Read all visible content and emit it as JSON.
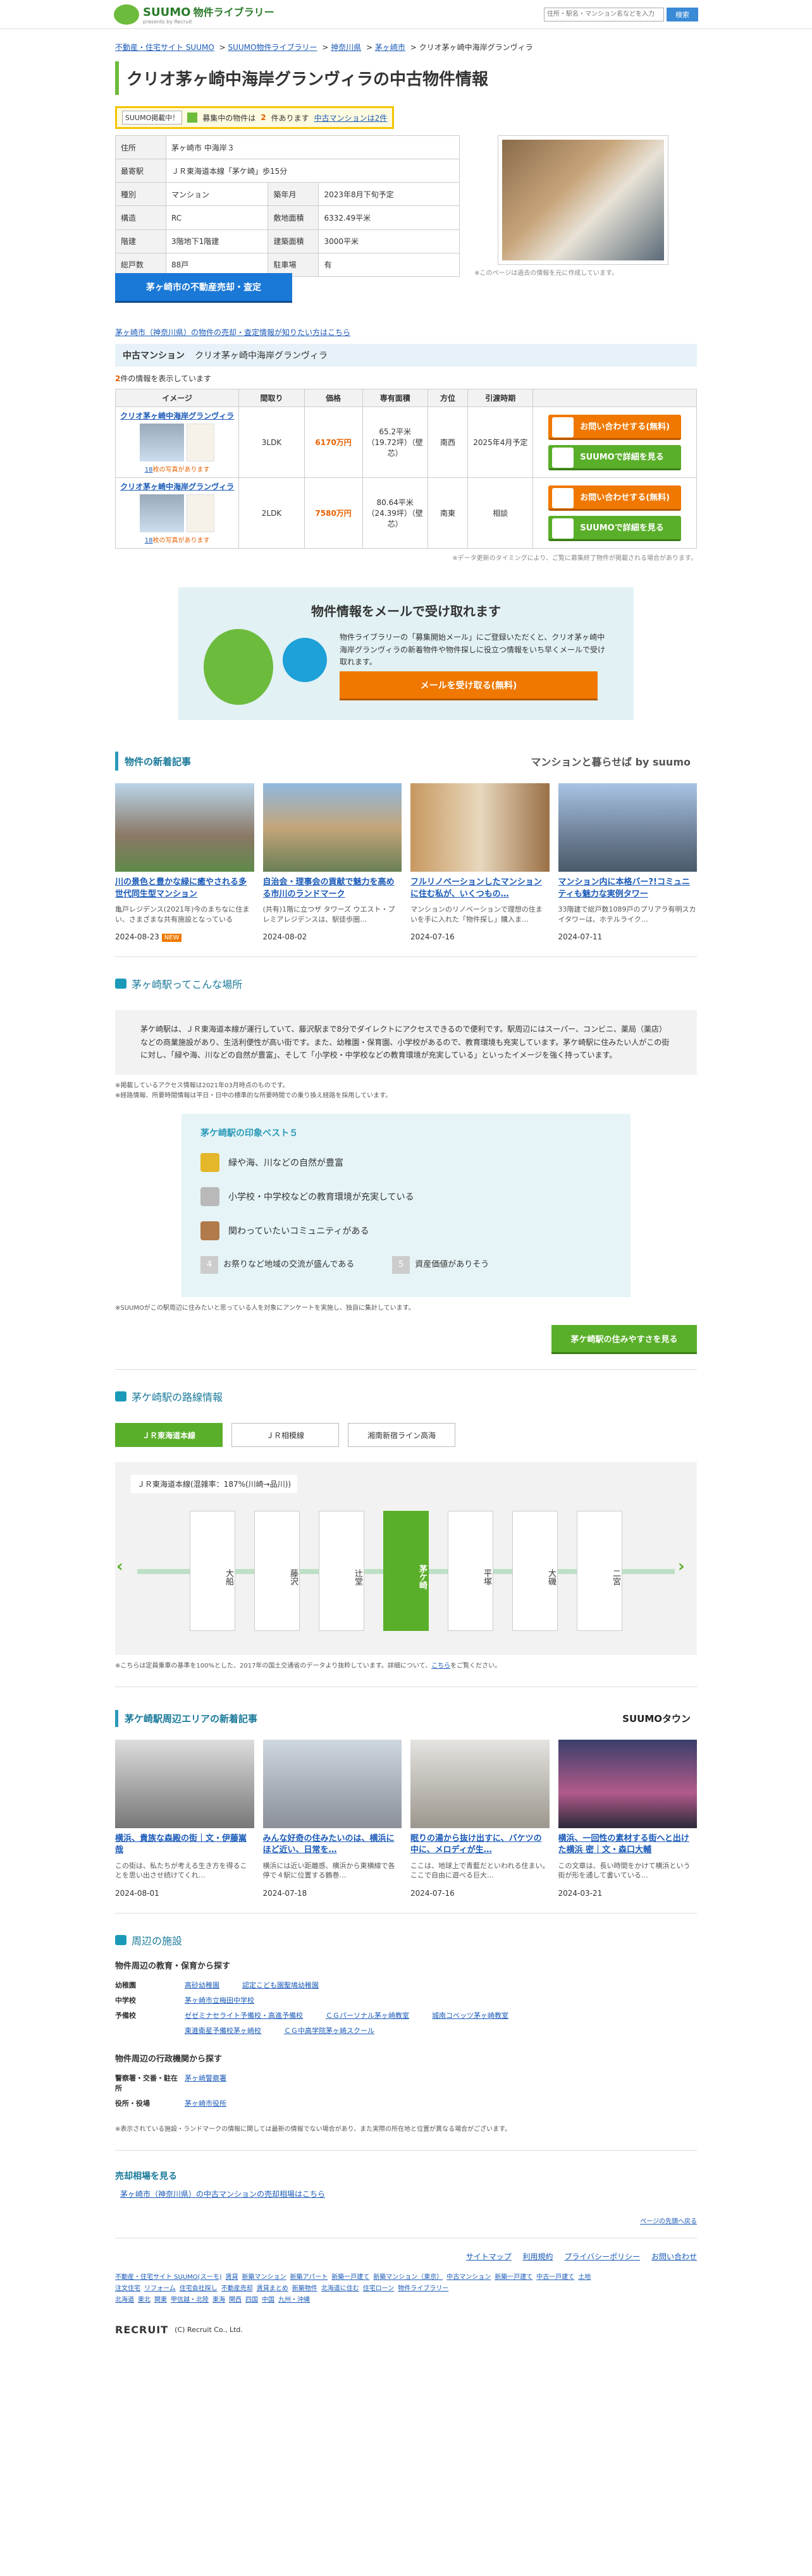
{
  "header": {
    "brand": "SUUMO",
    "brand2": "物件",
    "brand3": "ライブラリー",
    "tagline": "presents by Recruit",
    "search_placeholder": "住所・駅名・マンション名などを入力",
    "search_btn": "検索"
  },
  "crumbs": [
    "不動産・住宅サイト SUUMO",
    "SUUMO物件ライブラリー",
    "神奈川県",
    "茅ヶ崎市",
    "クリオ茅ヶ崎中海岸グランヴィラ"
  ],
  "title": "クリオ茅ヶ崎中海岸グランヴィラの中古物件情報",
  "notice": {
    "tag": "SUUMO掲載中！",
    "text1": "募集中の物件は",
    "n": "2",
    "text2": "件あります",
    "link": "中古マンションは2件"
  },
  "info": [
    {
      "k": "住所",
      "v": "茅ヶ崎市 中海岸３",
      "k2": "",
      "v2": ""
    },
    {
      "k": "最寄駅",
      "v": "ＪＲ東海道本線「茅ケ崎」歩15分",
      "k2": "",
      "v2": ""
    },
    {
      "k": "種別",
      "v": "マンション",
      "k2": "築年月",
      "v2": "2023年8月下旬予定"
    },
    {
      "k": "構造",
      "v": "RC",
      "k2": "敷地面積",
      "v2": "6332.49平米"
    },
    {
      "k": "階建",
      "v": "3階地下1階建",
      "k2": "建築面積",
      "v2": "3000平米"
    },
    {
      "k": "総戸数",
      "v": "88戸",
      "k2": "駐車場",
      "v2": "有"
    }
  ],
  "photo_note": "※このページは過去の情報を元に作成しています。",
  "sell_btn": "茅ヶ崎市の不動産売却・査定",
  "link_sell": "茅ヶ崎市（神奈川県）の物件の売却・査定情報が知りたい方はこちら",
  "section": {
    "label": "中古マンション",
    "name": "クリオ茅ヶ崎中海岸グランヴィラ"
  },
  "count": {
    "n": "2",
    "t": "件の情報を表示しています"
  },
  "table_headers": [
    "イメージ",
    "間取り",
    "価格",
    "専有面積",
    "方位",
    "引渡時期",
    ""
  ],
  "rows": [
    {
      "name": "クリオ茅ヶ崎中海岸グランヴィラ",
      "photos": "18",
      "photo_t": "枚の写真があります",
      "madori": "3LDK",
      "price": "6170万円",
      "area": "65.2平米（19.72坪）（壁芯）",
      "dir": "南西",
      "hand": "2025年4月予定"
    },
    {
      "name": "クリオ茅ヶ崎中海岸グランヴィラ",
      "photos": "18",
      "photo_t": "枚の写真があります",
      "madori": "2LDK",
      "price": "7580万円",
      "area": "80.64平米（24.39坪）（壁芯）",
      "dir": "南東",
      "hand": "相談"
    }
  ],
  "btn_inquiry": "お問い合わせする(無料)",
  "btn_detail": "SUUMOで詳細を見る",
  "table_note": "※データ更新のタイミングにより、ご覧に募集終了物件が掲載される場合があります。",
  "mail": {
    "title": "物件情報をメールで受け取れます",
    "text": "物件ライブラリーの「募集開始メール」にご登録いただくと、クリオ茅ヶ崎中海岸グランヴィラの新着物件や物件探しに役立つ情報をいち早くメールで受け取れます。",
    "btn": "メールを受け取る(無料)"
  },
  "news": {
    "title": "物件の新着記事",
    "logo": "マンションと暮らせば by suumo",
    "items": [
      {
        "t": "川の景色と豊かな緑に癒やされる多世代同生型マンション",
        "p": "亀戸レジデンス(2021年)今のまちなに住まい、さまざまな共有施設となっている",
        "d": "2024-08-23",
        "new": "NEW"
      },
      {
        "t": "自治会・理事会の貢献で魅力を高める市川のランドマーク",
        "p": "(共有)1階に立つザ タワーズ ウエスト・プレミアレジデンスは、駅徒歩圏…",
        "d": "2024-08-02",
        "new": ""
      },
      {
        "t": "フルリノベーションしたマンションに住む私が、いくつもの…",
        "p": "マンションのリノベーションで理想の住まいを手に入れた「物件探し」購入ま…",
        "d": "2024-07-16",
        "new": ""
      },
      {
        "t": "マンション内に本格バー?!コミュニティも魅力な実例タワー",
        "p": "33階建で総戸数1089戸のプリアラ有明スカイタワーは、ホテルライク…",
        "d": "2024-07-11",
        "new": ""
      }
    ]
  },
  "station": {
    "title": "茅ヶ崎駅ってこんな場所",
    "about": "茅ケ崎駅は、ＪＲ東海道本線が運行していて、藤沢駅まで8分でダイレクトにアクセスできるので便利です。駅周辺にはスーパー、コンビニ、薬局（薬店）などの商業施設があり、生活利便性が高い街です。また、幼稚園・保育園、小学校があるので、教育環境も充実しています。茅ケ崎駅に住みたい人がこの街に対し、「緑や海、川などの自然が豊富」、そして「小学校・中学校などの教育環境が充実している」といったイメージを強く持っています。",
    "note1": "※掲載しているアクセス情報は2021年03月時点のものです。",
    "note2": "※経路情報、所要時間情報は平日・日中の標準的な所要時間での乗り換え経路を採用しています。",
    "best_title": "茅ケ崎駅の印象ベスト５",
    "best": [
      "緑や海、川などの自然が豊富",
      "小学校・中学校などの教育環境が充実している",
      "関わっていたいコミュニティがある",
      "お祭りなど地域の交流が盛んである",
      "資産価値がありそう"
    ],
    "best_note": "※SUUMOがこの駅周辺に住みたいと思っている人を対象にアンケートを実施し、独自に集計しています。",
    "btn": "茅ケ崎駅の住みやすさを見る"
  },
  "route": {
    "title": "茅ケ崎駅の路線情報",
    "tabs": [
      "ＪＲ東海道本線",
      "ＪＲ相模線",
      "湘南新宿ライン高海"
    ],
    "caption": "ＪＲ東海道本線(混雑率：187%(川崎→品川))",
    "stations": [
      "大船",
      "藤沢",
      "辻堂",
      "茅ケ崎",
      "平塚",
      "大磯",
      "二宮"
    ],
    "note": "※こちらは定員乗車の基準を100%とした、2017年の国土交通省のデータより抜粋しています。詳細について、",
    "note_link": "こちら",
    "note_end": "をご覧ください。"
  },
  "area_news": {
    "title": "茅ケ崎駅周辺エリアの新着記事",
    "logo": "SUUMOタウン",
    "items": [
      {
        "t": "横浜、貴族な森殿の街｜文・伊藤嵩哉",
        "p": "この街は、私たちが考える生き方を得ることを思い出させ続けてくれ…",
        "d": "2024-08-01"
      },
      {
        "t": "みんな好奇の住みたいのは、横浜にほど近い、日常を…",
        "p": "横浜には近い距離感、横浜から東横線で各停で４駅に位置する鶴巻…",
        "d": "2024-07-18"
      },
      {
        "t": "眠りの湯から抜け出すに、バケツの中に、メロディが生…",
        "p": "ここは、地球上で青藍だといわれる住まい。ここで自由に遊べる巨大…",
        "d": "2024-07-16"
      },
      {
        "t": "横浜、一回性の素材する街へと出けた横浜 密｜文・森口大輔",
        "p": "この文章は、長い時間をかけて横浜という街が形を通して書いている…",
        "d": "2024-03-21"
      }
    ]
  },
  "facility": {
    "title": "周辺の施設",
    "edu": "物件周辺の教育・保育から探す",
    "rows": [
      {
        "k": "幼稚園",
        "v": [
          "高砂幼稚園",
          "認定こども園聖鳩幼稚園"
        ]
      },
      {
        "k": "中学校",
        "v": [
          "茅ヶ崎市立梅田中学校"
        ]
      },
      {
        "k": "予備校",
        "v": [
          "ゼゼミナセライト予備校・高進予備校",
          "ＣＧパーソナル茅ヶ崎教室",
          "城南コベッツ茅ヶ崎教室",
          "東進衛星予備校茅ヶ崎校",
          "ＣＧ中高学院茅ヶ崎スクール"
        ]
      }
    ],
    "gov": "物件周辺の行政機関から探す",
    "rows2": [
      {
        "k": "警察署・交番・駐在所",
        "v": [
          "茅ヶ崎警察署"
        ]
      },
      {
        "k": "役所・役場",
        "v": [
          "茅ヶ崎市役所"
        ]
      }
    ],
    "note": "※表示されている施設・ランドマークの情報に関しては最新の情報でない場合があり、また実際の所在地と位置が異なる場合がございます。"
  },
  "price": {
    "title": "売却相場を見る",
    "link": "茅ヶ崎市（神奈川県）の中古マンションの売却相場はこちら"
  },
  "top": "ページの先頭へ戻る",
  "footer": {
    "links": [
      "サイトマップ",
      "利用規約",
      "プライバシーポリシー",
      "お問い合わせ"
    ],
    "map1": [
      "不動産・住宅サイト SUUMO(スーモ)",
      "賃貸",
      "新築マンション",
      "新築アパート",
      "新築一戸建て",
      "新築マンション（東京）",
      "中古マンション",
      "新築一戸建て",
      "中古一戸建て",
      "土地"
    ],
    "map2": [
      "注文住宅",
      "リフォーム",
      "住宅会社探し",
      "不動産売却",
      "賃貸まとめ",
      "新築物件",
      "北海道に住む",
      "住宅ローン",
      "物件ライブラリー"
    ],
    "map3": [
      "北海道",
      "東北",
      "関東",
      "甲信越・北陸",
      "東海",
      "関西",
      "四国",
      "中国",
      "九州・沖縄"
    ],
    "recruit": "RECRUIT",
    "copy": "(C) Recruit Co., Ltd."
  }
}
